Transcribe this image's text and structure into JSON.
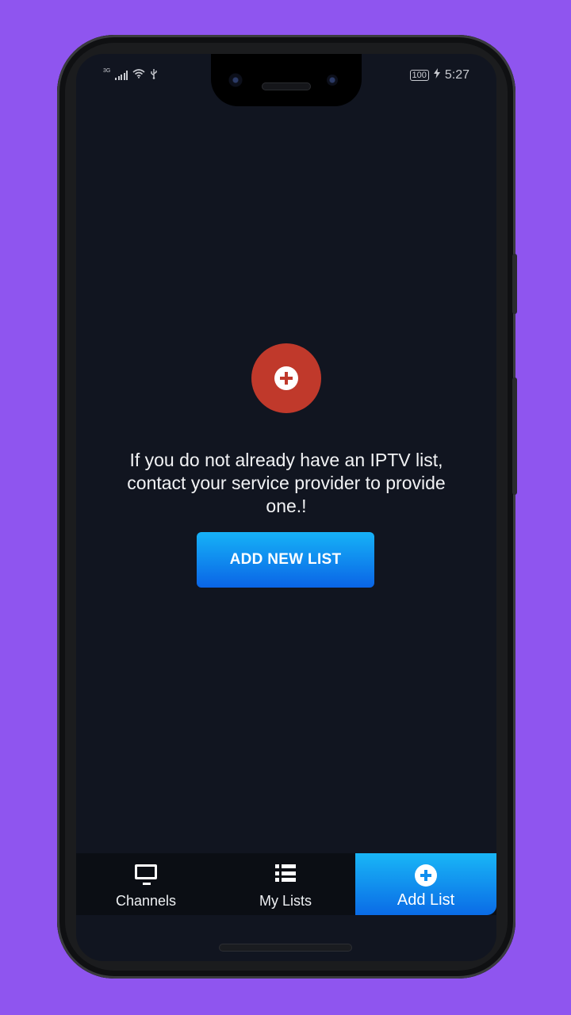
{
  "status_bar": {
    "network": "3G",
    "battery": "100",
    "time": "5:27"
  },
  "empty_state": {
    "message": "If you do not already have an IPTV list, contact your service provider to provide one.!",
    "button_label": "ADD NEW LIST"
  },
  "nav": {
    "items": [
      {
        "label": "Channels",
        "icon": "tv-icon"
      },
      {
        "label": "My Lists",
        "icon": "list-icon"
      },
      {
        "label": "Add List",
        "icon": "plus-circle-icon"
      }
    ]
  },
  "colors": {
    "background": "#8f55ef",
    "screen": "#111520",
    "fab": "#c0392b",
    "accent_start": "#16b2f7",
    "accent_end": "#0a64e6"
  }
}
